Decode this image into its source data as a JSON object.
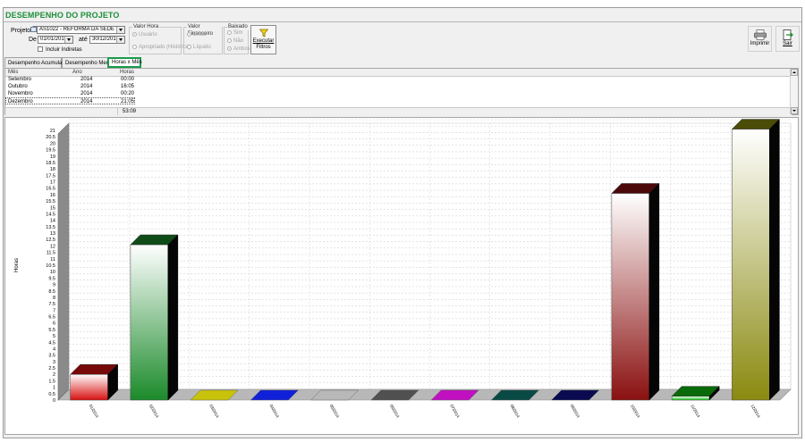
{
  "window": {
    "title": "DESEMPENHO DO PROJETO"
  },
  "filters": {
    "projeto_label": "Projeto",
    "projeto_value": "AS1022 - REFORMA DA SEDE",
    "de_label": "De",
    "de_value": "01/01/2014",
    "ate_label": "até",
    "ate_value": "30/12/2014",
    "incluir_indiretas_label": "Incluir Indiretas",
    "valor_hora": {
      "title": "Valor Hora",
      "options": [
        "Usuário",
        "Apropriado (Histórico)"
      ]
    },
    "valor_financeiro": {
      "title": "Valor Financeiro",
      "options": [
        "Bruto",
        "Líquido"
      ]
    },
    "baixado": {
      "title": "Baixado",
      "options": [
        "Sim",
        "Não",
        "Ambos"
      ]
    },
    "executar_line1": "Executar",
    "executar_line2": "Filtros",
    "funnel_icon": "funnel-icon"
  },
  "actions": {
    "imprimir": "Imprimir",
    "sair": "Sair",
    "printer_icon": "printer-icon",
    "exit_icon": "exit-icon"
  },
  "tabs": [
    {
      "label": "Desempenho Acumulado",
      "active": false
    },
    {
      "label": "Desempenho Mensal",
      "active": false
    },
    {
      "label": "Horas x Mês",
      "active": true
    }
  ],
  "grid": {
    "columns": [
      "Mês",
      "Ano",
      "Horas"
    ],
    "rows": [
      {
        "mes": "Setembro",
        "ano": "2014",
        "horas": "00:00"
      },
      {
        "mes": "Outubro",
        "ano": "2014",
        "horas": "16:05"
      },
      {
        "mes": "Novembro",
        "ano": "2014",
        "horas": "00:20"
      },
      {
        "mes": "Dezembro",
        "ano": "2014",
        "horas": "21:05"
      }
    ],
    "total": "53:09"
  },
  "chart_data": {
    "type": "bar",
    "ylabel": "Horas",
    "ylim": [
      0,
      21
    ],
    "ytick_step": 0.5,
    "categories": [
      "01/2014",
      "02/2014",
      "03/2014",
      "04/2014",
      "05/2014",
      "06/2014",
      "07/2014",
      "08/2014",
      "09/2014",
      "10/2014",
      "11/2014",
      "12/2014"
    ],
    "values": [
      2.0,
      12.1,
      0.0,
      0.0,
      0.0,
      0.0,
      0.0,
      0.0,
      0.0,
      16.1,
      0.3,
      21.1
    ],
    "colors": [
      "#d81010",
      "#1b8a2a",
      "#c8c20a",
      "#1020d8",
      "#b8b8b8",
      "#505050",
      "#c010c0",
      "#0a4a44",
      "#0a0a50",
      "#8a1010",
      "#10c010",
      "#8a8a10"
    ],
    "grid": true,
    "3d": true
  }
}
